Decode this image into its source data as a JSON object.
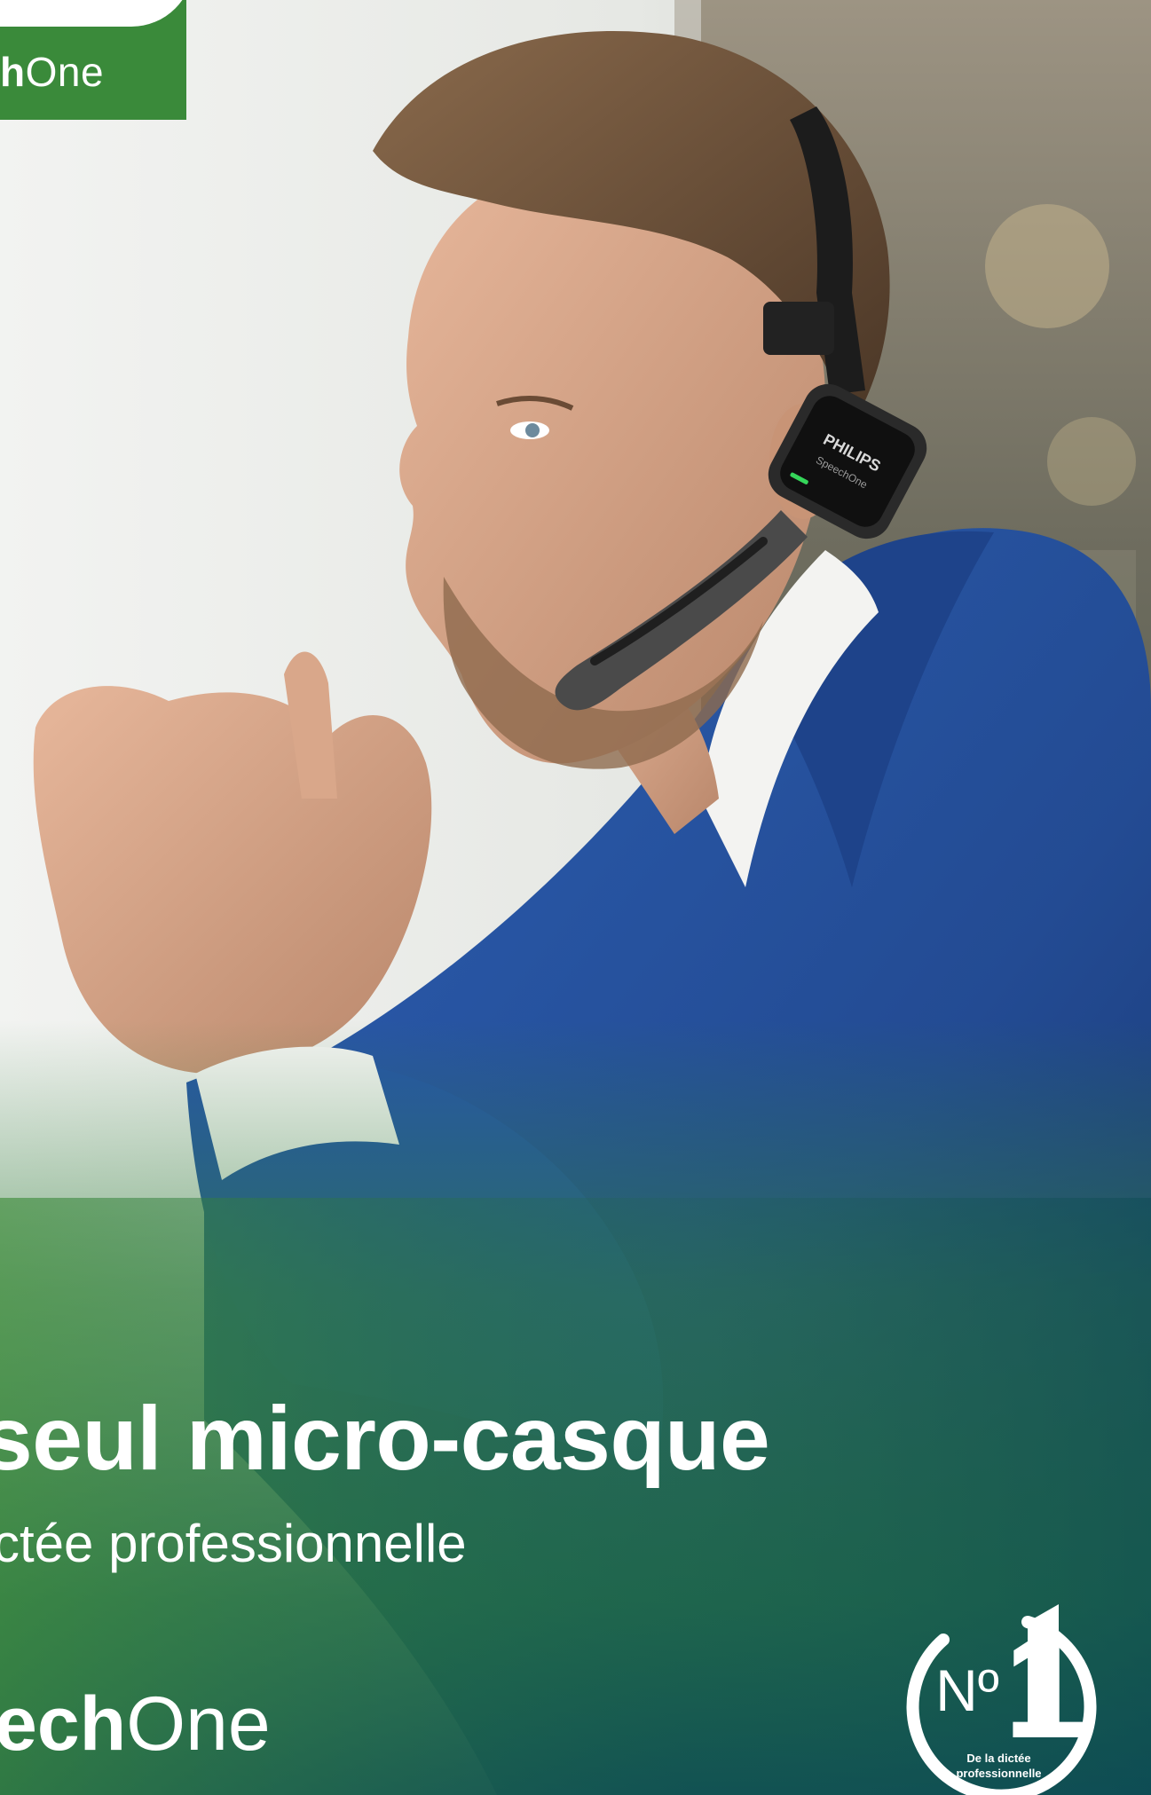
{
  "brand": {
    "tab_bold": "h",
    "tab_light": "One"
  },
  "campaign": {
    "headline": "seul micro-casque",
    "subline": "ctée professionnelle",
    "product_bold": "ech",
    "product_light": "One"
  },
  "headset": {
    "logo_text": "PHILIPS",
    "model_text": "SpeechOne"
  },
  "badge": {
    "number_mark": "Nº",
    "number": "1",
    "caption_line1": "De la dictée",
    "caption_line2": "professionnelle"
  },
  "colors": {
    "brand_green": "#3a8a3a",
    "gradient_green": "#2f7d3a",
    "gradient_teal": "#0f4f52",
    "jacket_blue": "#244e9a",
    "led_green": "#35d65a"
  }
}
